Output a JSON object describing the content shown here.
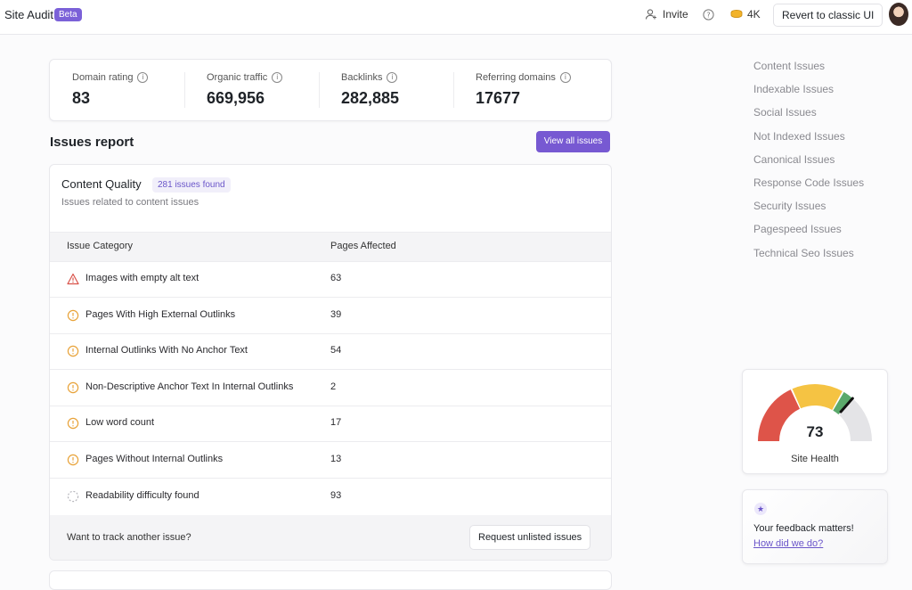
{
  "header": {
    "app_title": "Site Audit",
    "beta_badge": "Beta",
    "invite_label": "Invite",
    "credits": "4K",
    "revert_label": "Revert to classic UI"
  },
  "stats": [
    {
      "label": "Domain rating",
      "value": "83"
    },
    {
      "label": "Organic traffic",
      "value": "669,956"
    },
    {
      "label": "Backlinks",
      "value": "282,885"
    },
    {
      "label": "Referring domains",
      "value": "17677"
    }
  ],
  "issues_report": {
    "title": "Issues report",
    "view_all_label": "View all issues",
    "category_title": "Content Quality",
    "found_badge": "281 issues found",
    "subtitle": "Issues related to content issues",
    "columns": [
      "Issue Category",
      "Pages Affected"
    ],
    "rows": [
      {
        "icon": "warning-triangle-icon",
        "name": "Images with empty alt text",
        "pages": "63"
      },
      {
        "icon": "alert-circle-icon",
        "name": "Pages With High External Outlinks",
        "pages": "39"
      },
      {
        "icon": "alert-circle-icon",
        "name": "Internal Outlinks With No Anchor Text",
        "pages": "54"
      },
      {
        "icon": "alert-circle-icon",
        "name": "Non-Descriptive Anchor Text In Internal Outlinks",
        "pages": "2"
      },
      {
        "icon": "alert-circle-icon",
        "name": "Low word count",
        "pages": "17"
      },
      {
        "icon": "alert-circle-icon",
        "name": "Pages Without Internal Outlinks",
        "pages": "13"
      },
      {
        "icon": "dashed-circle-icon",
        "name": "Readability difficulty found",
        "pages": "93"
      }
    ],
    "footer_question": "Want to track another issue?",
    "request_label": "Request unlisted issues"
  },
  "side_nav": [
    "Content Issues",
    "Indexable Issues",
    "Social Issues",
    "Not Indexed Issues",
    "Canonical Issues",
    "Response Code Issues",
    "Security Issues",
    "Pagespeed Issues",
    "Technical Seo Issues"
  ],
  "site_health": {
    "score": "73",
    "label": "Site Health",
    "score_value": 73,
    "colors": {
      "red": "#de5449",
      "yellow": "#f5c343",
      "green": "#5aa96b",
      "grey": "#e4e4e7",
      "needle": "#111111"
    }
  },
  "feedback": {
    "title": "Your feedback matters!",
    "link": "How did we do?"
  },
  "colors": {
    "accent": "#7759d2",
    "warning_red": "#d9534a",
    "alert_orange": "#e8a33a"
  }
}
